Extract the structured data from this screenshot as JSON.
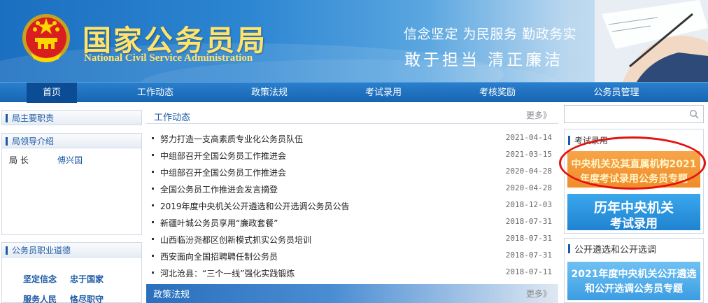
{
  "header": {
    "title_cn": "国家公务员局",
    "title_en": "National Civil Service Administration",
    "motto_line1": "信念坚定 为民服务 勤政务实",
    "motto_line2": "敢于担当  清正廉洁"
  },
  "nav": {
    "items": [
      {
        "label": "首页",
        "active": true
      },
      {
        "label": "工作动态"
      },
      {
        "label": "政策法规"
      },
      {
        "label": "考试录用"
      },
      {
        "label": "考核奖励"
      },
      {
        "label": "公务员管理"
      }
    ]
  },
  "left": {
    "duties_label": "局主要职责",
    "leaders_label": "局领导介绍",
    "leader_role": "局  长",
    "leader_name": "傅兴国",
    "ethics_label": "公务员职业道德",
    "ethics": [
      "坚定信念",
      "忠于国家",
      "服务人民",
      "恪尽职守"
    ]
  },
  "news": {
    "title": "工作动态",
    "more": "更多》",
    "items": [
      {
        "title": "努力打造一支高素质专业化公务员队伍",
        "date": "2021-04-14"
      },
      {
        "title": "中组部召开全国公务员工作推进会",
        "date": "2021-03-15"
      },
      {
        "title": "中组部召开全国公务员工作推进会",
        "date": "2020-04-28"
      },
      {
        "title": "全国公务员工作推进会发言摘登",
        "date": "2020-04-28"
      },
      {
        "title": "2019年度中央机关公开遴选和公开选调公务员公告",
        "date": "2018-12-03"
      },
      {
        "title": "新疆叶城公务员享用“廉政套餐”",
        "date": "2018-07-31"
      },
      {
        "title": "山西临汾尧都区创新模式抓实公务员培训",
        "date": "2018-07-31"
      },
      {
        "title": "西安面向全国招聘聘任制公务员",
        "date": "2018-07-31"
      },
      {
        "title": "河北沧县：“三个一线”强化实践锻炼",
        "date": "2018-07-11"
      }
    ]
  },
  "policy": {
    "title": "政策法规",
    "more": "更多》"
  },
  "search": {
    "placeholder": "",
    "icon": "search-icon"
  },
  "right": {
    "exam_title": "考试录用",
    "promo1_line1": "中央机关及其直属机构2021",
    "promo1_line2": "年度考试录用公务员专题",
    "promo2_line1": "历年中央机关",
    "promo2_line2": "考试录用",
    "select_title": "公开遴选和公开选调",
    "promo3_line1": "2021年度中央机关公开遴选",
    "promo3_line2": "和公开选调公务员专题"
  },
  "colors": {
    "brand_blue": "#1c5aa6",
    "nav_blue": "#1f70bf",
    "nav_active": "#0b4c95",
    "gold_title": "#ffe36b",
    "highlight_red": "#e4120d"
  }
}
